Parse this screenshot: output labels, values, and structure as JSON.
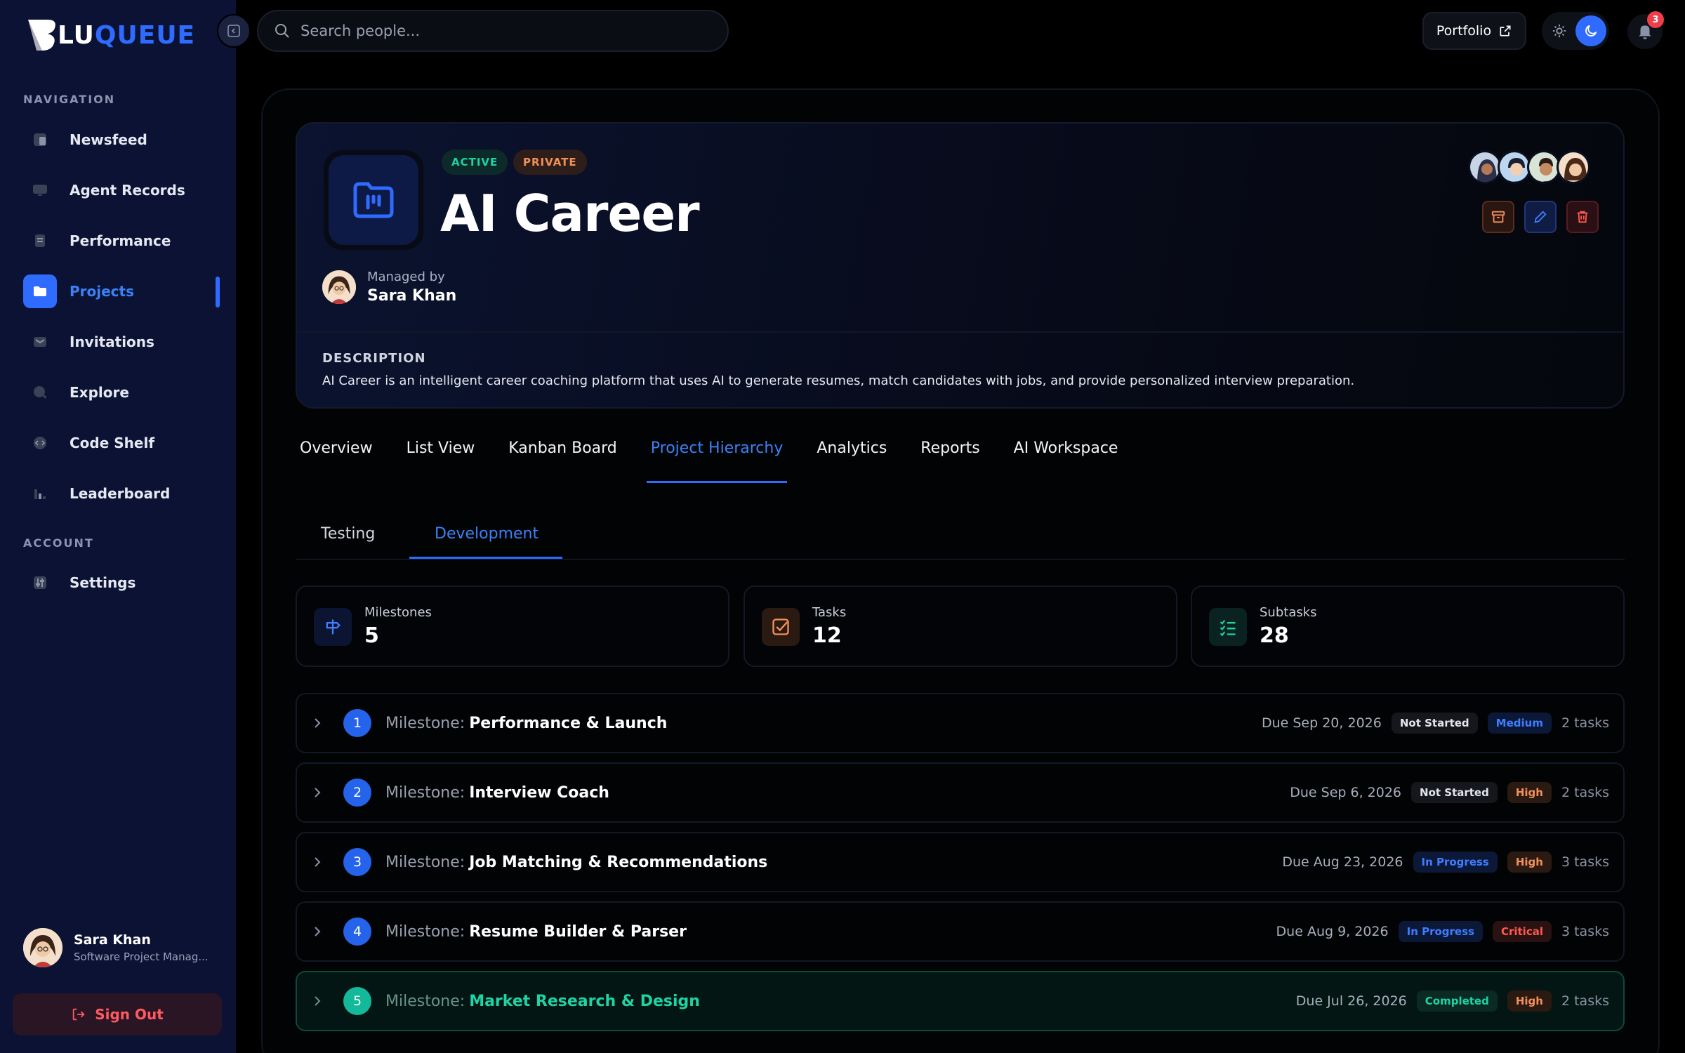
{
  "app": {
    "logo_lu": "LU",
    "logo_queue": "QUEUE"
  },
  "sidebar": {
    "nav_label": "NAVIGATION",
    "account_label": "ACCOUNT",
    "items": [
      {
        "label": "Newsfeed",
        "icon": "newsfeed-icon"
      },
      {
        "label": "Agent Records",
        "icon": "monitor-icon"
      },
      {
        "label": "Performance",
        "icon": "clipboard-icon"
      },
      {
        "label": "Projects",
        "icon": "folder-icon",
        "active": true
      },
      {
        "label": "Invitations",
        "icon": "mail-icon"
      },
      {
        "label": "Explore",
        "icon": "search-icon"
      },
      {
        "label": "Code Shelf",
        "icon": "code-icon"
      },
      {
        "label": "Leaderboard",
        "icon": "chart-icon"
      }
    ],
    "settings_label": "Settings",
    "user": {
      "name": "Sara Khan",
      "role": "Software Project Manag..."
    },
    "signout_label": "Sign Out"
  },
  "topbar": {
    "search_placeholder": "Search people...",
    "portfolio_label": "Portfolio",
    "notification_count": "3"
  },
  "project": {
    "status_badge": "ACTIVE",
    "visibility_badge": "PRIVATE",
    "title": "AI Career",
    "managed_by_label": "Managed by",
    "manager_name": "Sara Khan",
    "description_label": "DESCRIPTION",
    "description": "AI Career is an intelligent career coaching platform that uses AI to generate resumes, match candidates with jobs, and provide personalized interview preparation."
  },
  "tabs": [
    "Overview",
    "List View",
    "Kanban Board",
    "Project Hierarchy",
    "Analytics",
    "Reports",
    "AI Workspace"
  ],
  "active_tab": "Project Hierarchy",
  "subtabs": {
    "testing": "Testing",
    "development": "Development"
  },
  "stats": [
    {
      "label": "Milestones",
      "value": "5"
    },
    {
      "label": "Tasks",
      "value": "12"
    },
    {
      "label": "Subtasks",
      "value": "28"
    }
  ],
  "milestone_prefix": "Milestone:",
  "milestones": [
    {
      "num": "1",
      "name": "Performance & Launch",
      "due": "Due Sep 20, 2026",
      "status": "Not Started",
      "priority": "Medium",
      "count": "2 tasks"
    },
    {
      "num": "2",
      "name": "Interview Coach",
      "due": "Due Sep 6, 2026",
      "status": "Not Started",
      "priority": "High",
      "count": "2 tasks"
    },
    {
      "num": "3",
      "name": "Job Matching & Recommendations",
      "due": "Due Aug 23, 2026",
      "status": "In Progress",
      "priority": "High",
      "count": "3 tasks"
    },
    {
      "num": "4",
      "name": "Resume Builder & Parser",
      "due": "Due Aug 9, 2026",
      "status": "In Progress",
      "priority": "Critical",
      "count": "3 tasks"
    },
    {
      "num": "5",
      "name": "Market Research & Design",
      "due": "Due Jul 26, 2026",
      "status": "Completed",
      "priority": "High",
      "count": "2 tasks"
    }
  ],
  "colors": {
    "accent": "#2f6bff",
    "success": "#1fd3a4",
    "warning": "#f3905a",
    "danger": "#ff5a4f",
    "sidebar_bg": "#0b1233"
  }
}
